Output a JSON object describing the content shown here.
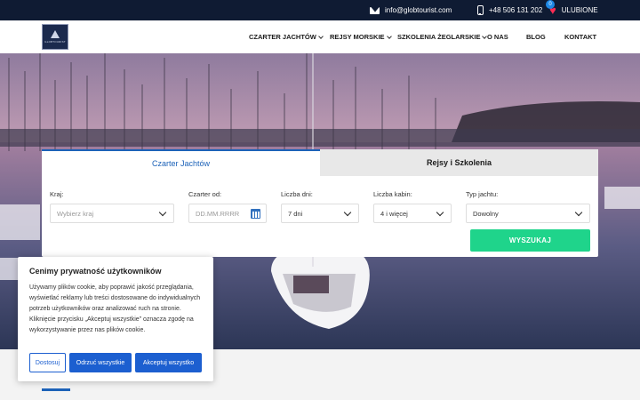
{
  "topbar": {
    "email": "info@globtourist.com",
    "phone": "+48 506 131 202",
    "favorites_count": "0",
    "favorites_label": "ULUBIONE"
  },
  "header": {
    "logo_text": "GLOBTOURIST",
    "nav": [
      {
        "label": "CZARTER JACHTÓW",
        "has_dropdown": true
      },
      {
        "label": "REJSY MORSKIE",
        "has_dropdown": true
      },
      {
        "label": "SZKOLENIA ŻEGLARSKIE",
        "has_dropdown": true
      },
      {
        "label": "O NAS",
        "has_dropdown": false
      },
      {
        "label": "BLOG",
        "has_dropdown": false
      },
      {
        "label": "KONTAKT",
        "has_dropdown": false
      }
    ]
  },
  "search": {
    "tabs": [
      {
        "label": "Czarter Jachtów",
        "active": true
      },
      {
        "label": "Rejsy i Szkolenia",
        "active": false
      }
    ],
    "fields": {
      "country": {
        "label": "Kraj:",
        "placeholder": "Wybierz kraj"
      },
      "charter_from": {
        "label": "Czarter od:",
        "placeholder": "DD.MM.RRRR"
      },
      "days": {
        "label": "Liczba dni:",
        "value": "7 dni"
      },
      "cabins": {
        "label": "Liczba kabin:",
        "value": "4 i więcej"
      },
      "yacht_type": {
        "label": "Typ jachtu:",
        "value": "Dowolny"
      }
    },
    "submit_label": "WYSZUKAJ"
  },
  "cookie": {
    "title": "Cenimy prywatność użytkowników",
    "body": "Używamy plików cookie, aby poprawić jakość przeglądania, wyświetlać reklamy lub treści dostosowane do indywidualnych potrzeb użytkowników oraz analizować ruch na stronie. Kliknięcie przycisku „Akceptuj wszystkie” oznacza zgodę na wykorzystywanie przez nas plików cookie.",
    "adjust_label": "Dostosuj",
    "reject_label": "Odrzuć wszystkie",
    "accept_label": "Akceptuj wszystko"
  },
  "colors": {
    "topbar": "#0f1b33",
    "accent": "#1c62b8",
    "search_button": "#1fd48b",
    "cookie_button": "#1c5fd0",
    "heart": "#ff2d55"
  },
  "icons": [
    "mail-icon",
    "phone-icon",
    "heart-icon",
    "chevron-down-icon",
    "calendar-icon"
  ]
}
